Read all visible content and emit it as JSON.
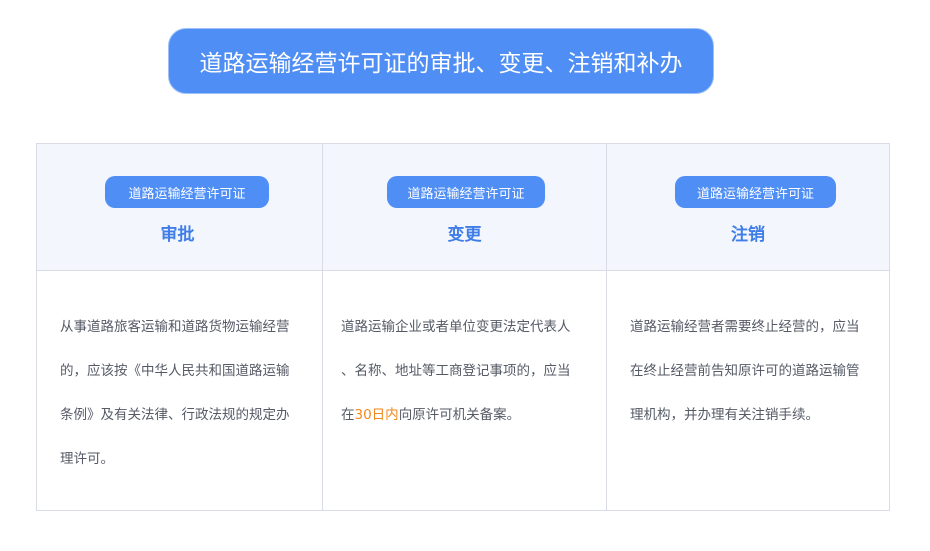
{
  "title": "道路运输经营许可证的审批、变更、注销和补办",
  "columns": [
    {
      "tag": "道路运输经营许可证",
      "action": "审批",
      "lines": [
        "从事道路旅客运输和道路货物运输经营",
        "的，应该按《中华人民共和国道路运输",
        "条例》及有关法律、行政法规的规定办",
        "理许可。"
      ]
    },
    {
      "tag": "道路运输经营许可证",
      "action": "变更",
      "lines": [
        "道路运输企业或者单位变更法定代表人",
        "、名称、地址等工商登记事项的，应当"
      ],
      "line3_prefix": "在",
      "line3_highlight": "30日内",
      "line3_suffix": "向原许可机关备案。",
      "highlight_color": "#f08a1d"
    },
    {
      "tag": "道路运输经营许可证",
      "action": "注销",
      "lines": [
        "道路运输经营者需要终止经营的，应当",
        "在终止经营前告知原许可的道路运输管",
        "理机构，并办理有关注销手续。"
      ]
    }
  ],
  "colors": {
    "accent": "#4f8ef5",
    "action_text": "#3f7de8",
    "header_bg": "#f4f6fd",
    "border": "#d9dce6",
    "body_text": "#555a66"
  }
}
